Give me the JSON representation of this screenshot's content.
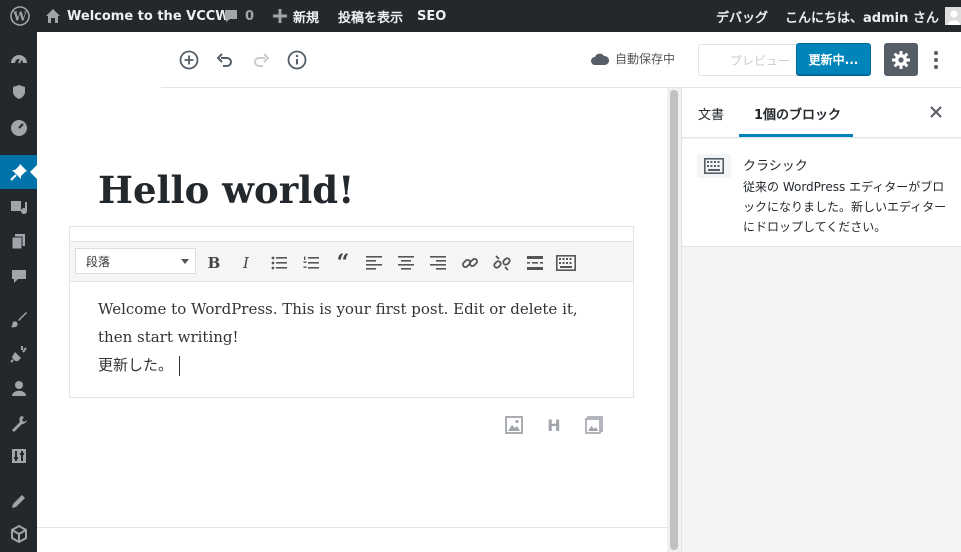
{
  "adminbar": {
    "site_title": "Welcome to the VCCW",
    "comments_count": "0",
    "new_label": "新規",
    "view_post": "投稿を表示",
    "seo": "SEO",
    "debug": "デバッグ",
    "greeting": "こんにちは、admin さん"
  },
  "topbar": {
    "saving": "自動保存中",
    "preview": "プレビュー",
    "update": "更新中..."
  },
  "editor": {
    "title": "Hello world!",
    "format_select": "段落",
    "content_line1": "Welcome to WordPress. This is your first post. Edit or delete it,",
    "content_line2": "then start writing!",
    "content_line3": "更新した。"
  },
  "panel": {
    "tab_document": "文書",
    "tab_block": "1個のブロック",
    "block_title": "クラシック",
    "block_desc": "従来の WordPress エディターがブロックになりました。新しいエディターにドロップしてください。"
  },
  "colors": {
    "adminbar_bg": "#23282d",
    "accent": "#0073aa",
    "update_button": "#0085ba"
  }
}
